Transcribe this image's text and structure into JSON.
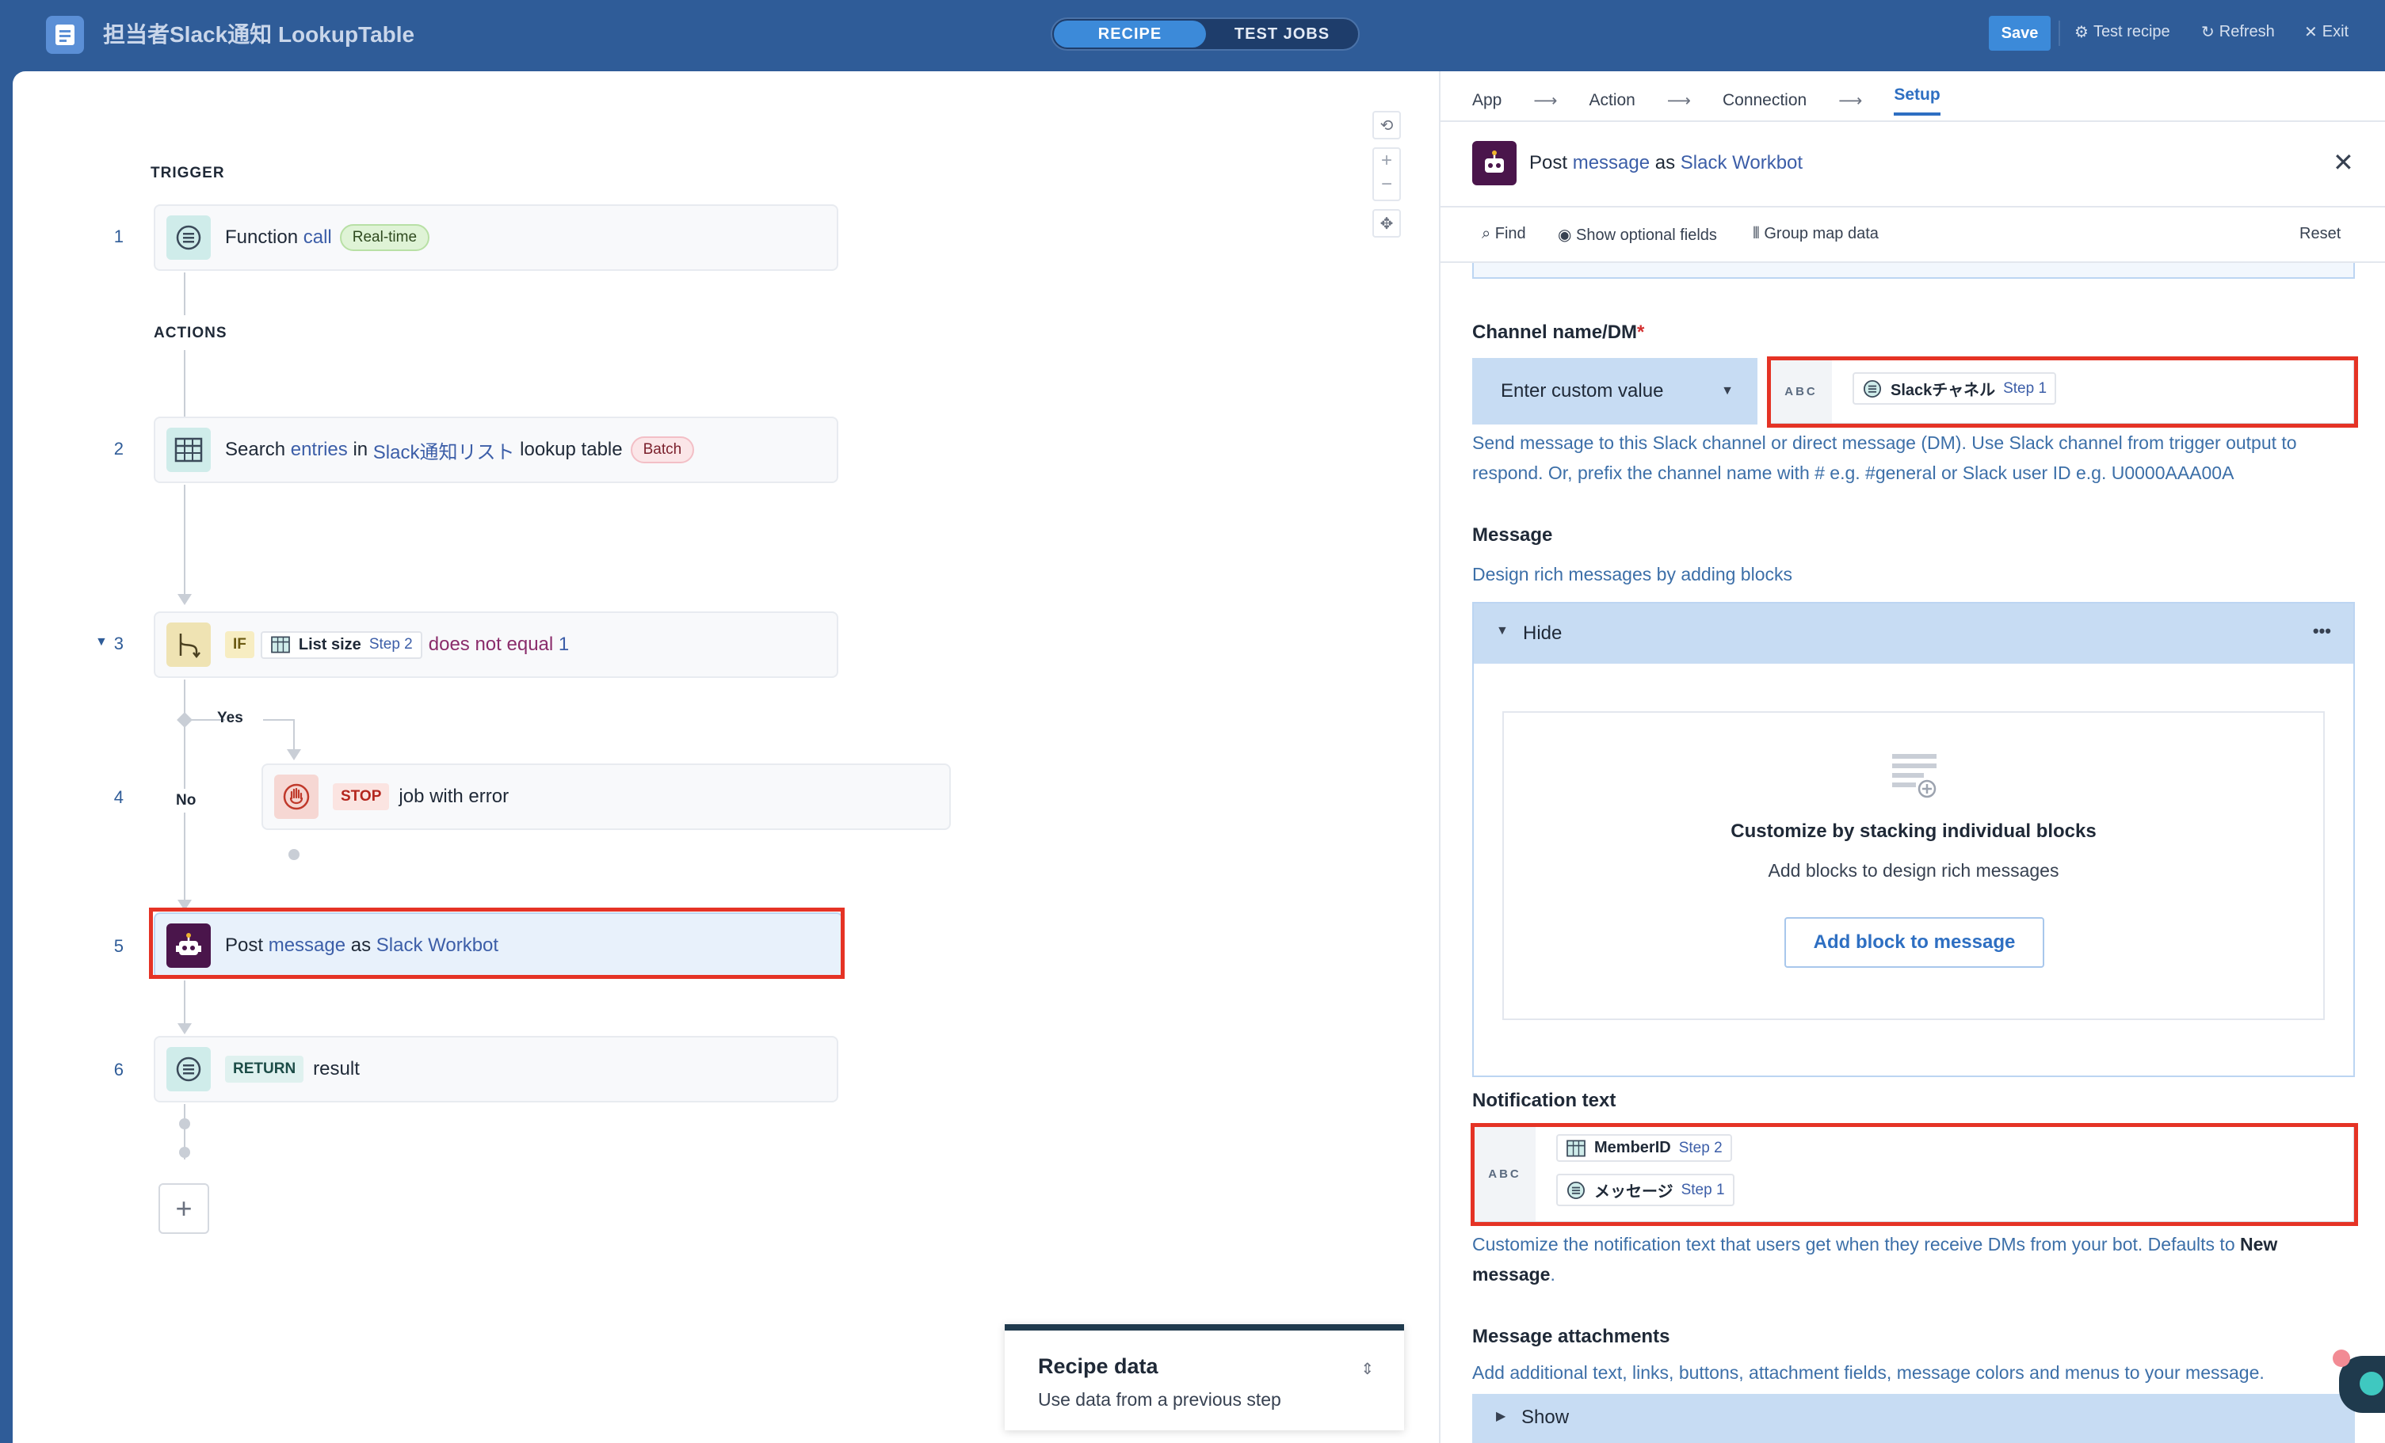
{
  "app": {
    "title": "担当者Slack通知 LookupTable",
    "tabs": [
      "RECIPE",
      "TEST JOBS"
    ],
    "save_label": "Save",
    "test_recipe": "Test recipe",
    "refresh": "Refresh",
    "exit": "Exit"
  },
  "flow": {
    "trigger_label": "TRIGGER",
    "actions_label": "ACTIONS",
    "steps": {
      "s1": {
        "num": "1",
        "pre": "Function",
        "link": "call",
        "badge": "Real-time"
      },
      "s2": {
        "num": "2",
        "pre": "Search",
        "link1": "entries",
        "mid": "in",
        "link2": "Slack通知リスト",
        "post": "lookup table",
        "badge": "Batch"
      },
      "s3": {
        "num": "3",
        "if": "IF",
        "chip_label": "List size",
        "chip_step": "Step 2",
        "cond": "does not equal",
        "val": "1"
      },
      "s4": {
        "num": "4",
        "stop": "STOP",
        "text": "job with error"
      },
      "s5": {
        "num": "5",
        "pre": "Post",
        "link1": "message",
        "mid": "as",
        "link2": "Slack Workbot"
      },
      "s6": {
        "num": "6",
        "ret": "RETURN",
        "text": "result"
      }
    },
    "yes_label": "Yes",
    "no_label": "No",
    "add_symbol": "+",
    "recipe_data": {
      "title": "Recipe data",
      "subtitle": "Use data from a previous step"
    }
  },
  "panel": {
    "crumbs": [
      "App",
      "Action",
      "Connection",
      "Setup"
    ],
    "header": {
      "pre": "Post",
      "link1": "message",
      "mid": "as",
      "link2": "Slack Workbot"
    },
    "toolbar": {
      "find": "Find",
      "optional": "Show optional fields",
      "group": "Group map data",
      "reset": "Reset"
    },
    "channel": {
      "label": "Channel name/DM",
      "required": "*",
      "select": "Enter custom value",
      "type": "ABC",
      "pill_label": "Slackチャネル",
      "pill_step": "Step 1",
      "help": "Send message to this Slack channel or direct message (DM). Use Slack channel from trigger output to respond. Or, prefix the channel name with # e.g. #general or Slack user ID e.g. U0000AAA00A"
    },
    "message": {
      "label": "Message",
      "help": "Design rich messages by adding blocks",
      "toggle": "Hide",
      "more": "•••",
      "empty_title": "Customize by stacking individual blocks",
      "empty_sub": "Add blocks to design rich messages",
      "add_button": "Add block to message"
    },
    "notification": {
      "label": "Notification text",
      "type": "ABC",
      "pill1_label": "MemberID",
      "pill1_step": "Step 2",
      "pill2_label": "メッセージ",
      "pill2_step": "Step 1",
      "help_pre": "Customize the notification text that users get when they receive DMs from your bot. Defaults to",
      "help_bold": "New message",
      "help_end": "."
    },
    "attachments": {
      "label": "Message attachments",
      "help": "Add additional text, links, buttons, attachment fields, message colors and menus to your message.",
      "toggle": "Show"
    }
  },
  "colors": {
    "brand": "#2f5c98",
    "accent": "#3c8ad9",
    "highlight": "#e53325",
    "slack": "#4a154b"
  }
}
